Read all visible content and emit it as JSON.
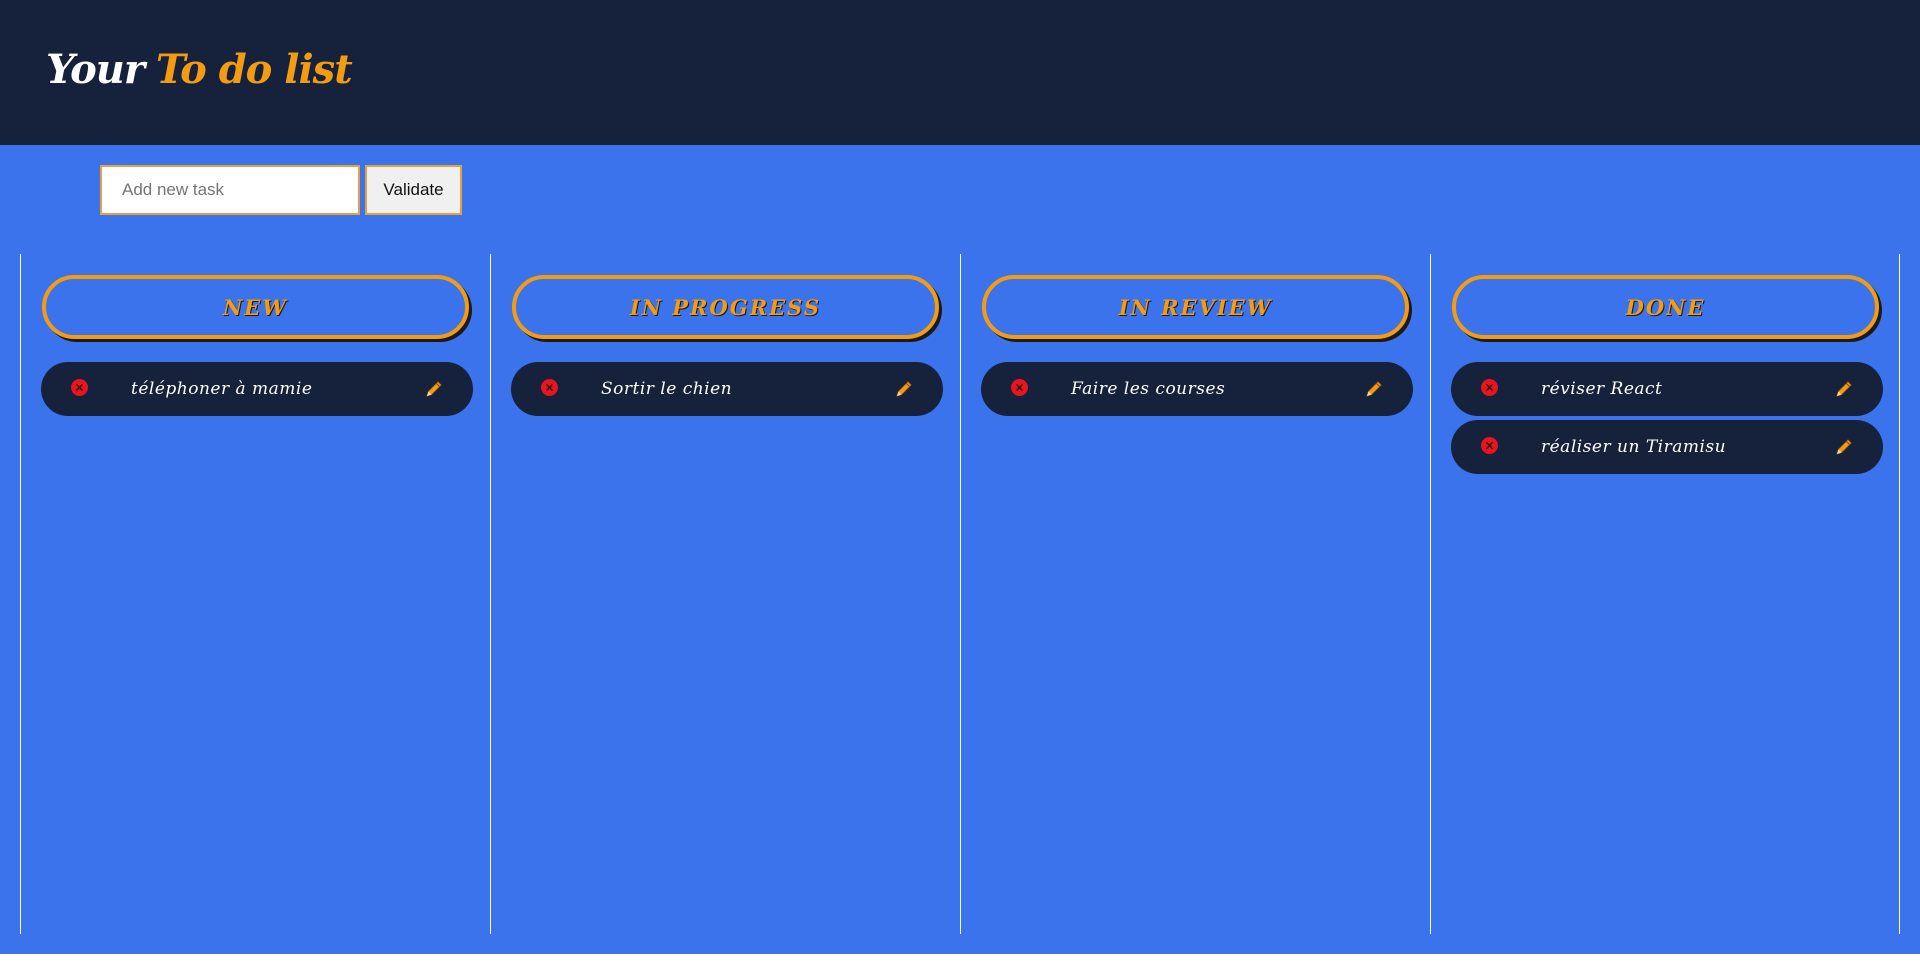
{
  "header": {
    "title_part_1": "Your",
    "title_part_2": "To do list"
  },
  "new_task": {
    "placeholder": "Add new task",
    "value": "",
    "button_label": "Validate"
  },
  "colors": {
    "header_bg": "#16213b",
    "main_bg": "#3b73ec",
    "accent": "#f39c12",
    "card_bg": "#16213b",
    "delete": "#e8141f"
  },
  "icons": {
    "delete": "close-circle-icon",
    "edit": "pencil-icon"
  },
  "columns": [
    {
      "title": "New",
      "tasks": [
        {
          "text": "téléphoner à mamie"
        }
      ]
    },
    {
      "title": "In progress",
      "tasks": [
        {
          "text": "Sortir le chien"
        }
      ]
    },
    {
      "title": "In review",
      "tasks": [
        {
          "text": "Faire les courses"
        }
      ]
    },
    {
      "title": "Done",
      "tasks": [
        {
          "text": "réviser React"
        },
        {
          "text": "réaliser un Tiramisu"
        }
      ]
    }
  ]
}
